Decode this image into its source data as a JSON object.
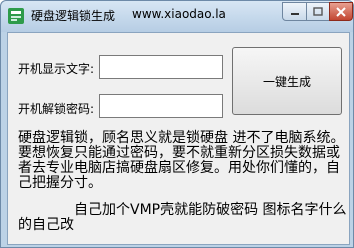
{
  "window": {
    "title": "硬盘逻辑锁生成",
    "website": "www.xiaodao.la"
  },
  "form": {
    "boot_display_label": "开机显示文字:",
    "boot_display_value": "",
    "boot_unlock_label": "开机解锁密码:",
    "boot_unlock_value": "",
    "generate_label": "一键生成"
  },
  "description": {
    "paragraph1": "硬盘逻辑锁，顾名思义就是锁硬盘 进不了电脑系统。要想恢复只能通过密码，要不就重新分区损失数据或者去专业电脑店搞硬盘扇区修复。用处你们懂的，自己把握分寸。",
    "paragraph2": "自己加个VMP壳就能防破密码  图标名字什么的自己改"
  }
}
